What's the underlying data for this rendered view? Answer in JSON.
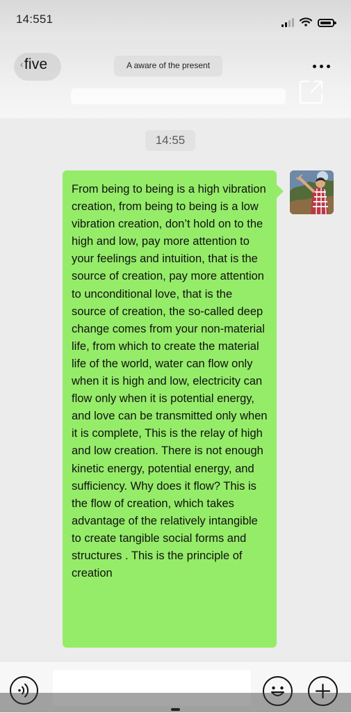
{
  "status_bar": {
    "time": "14:551",
    "icons": [
      "signal-icon",
      "wifi-icon",
      "battery-icon"
    ]
  },
  "header": {
    "back_label": "five",
    "back_icon": "back-chevron-icon",
    "title": "A aware of the present",
    "more_icon": "more-dots-icon",
    "share_icon": "share-out-icon"
  },
  "chat": {
    "timestamp": "14:55",
    "messages": [
      {
        "sender": "self",
        "avatar_icon": "profile-photo-icon",
        "text": "From being to being is a high vibration creation, from being to being is a low vibration creation, don’t hold on to the high and low, pay more attention to your feelings and intuition, that is the source of creation, pay more attention to unconditional love, that is the source of creation, the so-called deep change comes from your non-material life, from which to create the material life of the world, water can flow only when it is high and low, electricity can flow only when it is potential energy, and love can be transmitted only when it is complete, This is the relay of high and low creation. There is not enough kinetic energy, potential energy, and sufficiency. Why does it flow? This is the flow of creation, which takes advantage of the relatively intangible to create tangible social forms and structures . This is the principle of creation"
      }
    ]
  },
  "input_bar": {
    "placeholder": "",
    "voice_icon": "voice-icon",
    "emoji_icon": "emoji-icon",
    "plus_icon": "plus-icon"
  },
  "colors": {
    "bubble": "#95ec69",
    "background": "#ececec"
  }
}
